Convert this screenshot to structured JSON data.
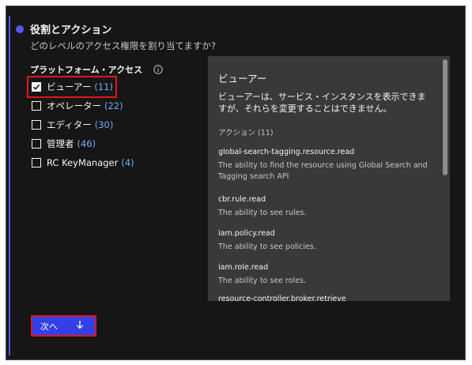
{
  "step": {
    "title": "役割とアクション",
    "description": "どのレベルのアクセス権限を割り当てますか?"
  },
  "platform_access": {
    "label": "プラットフォーム・アクセス",
    "info_icon": "info-icon",
    "roles": [
      {
        "name": "ビューアー",
        "count": "(11)",
        "checked": true
      },
      {
        "name": "オペレーター",
        "count": "(22)",
        "checked": false
      },
      {
        "name": "エディター",
        "count": "(30)",
        "checked": false
      },
      {
        "name": "管理者",
        "count": "(46)",
        "checked": false
      },
      {
        "name": "RC KeyManager",
        "count": "(4)",
        "checked": false
      }
    ]
  },
  "detail": {
    "title": "ビューアー",
    "description": "ビューアーは、サービス・インスタンスを表示できますが、それらを変更することはできません。",
    "actions_label": "アクション (11)",
    "actions": [
      {
        "name": "global-search-tagging.resource.read",
        "description": "The ability to find the resource using Global Search and Tagging search API"
      },
      {
        "name": "cbr.rule.read",
        "description": "The ability to see rules."
      },
      {
        "name": "iam.policy.read",
        "description": "The ability to see policies."
      },
      {
        "name": "iam.role.read",
        "description": "The ability to see roles."
      },
      {
        "name": "resource-controller.broker.retrieve",
        "description": ""
      }
    ]
  },
  "next_button": {
    "label": "次へ",
    "icon": "arrow-down-icon"
  },
  "colors": {
    "background": "#161616",
    "accent": "#4d5ce6",
    "button": "#3340e8",
    "highlight": "#e0171c",
    "count": "#78a9ff",
    "panel": "#393939"
  }
}
